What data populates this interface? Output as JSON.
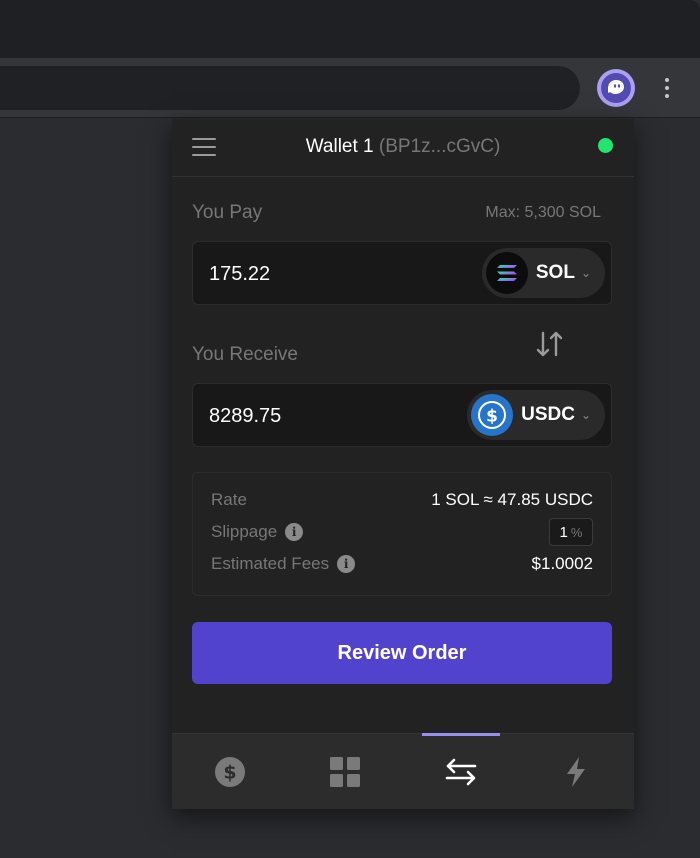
{
  "browser": {
    "extension_icon": "phantom-ghost-icon",
    "menu_icon": "kebab-menu-icon"
  },
  "header": {
    "wallet_name": "Wallet 1",
    "wallet_address": "(BP1z...cGvC)",
    "status_color": "#21e56f"
  },
  "pay": {
    "label": "You Pay",
    "max_label": "Max: 5,300 SOL",
    "amount": "175.22",
    "token": "SOL",
    "token_icon": "solana-icon"
  },
  "receive": {
    "label": "You Receive",
    "amount": "8289.75",
    "token": "USDC",
    "token_icon": "usdc-icon"
  },
  "details": {
    "rate_label": "Rate",
    "rate_value": "1 SOL ≈ 47.85 USDC",
    "slippage_label": "Slippage",
    "slippage_value": "1",
    "slippage_unit": "%",
    "fees_label": "Estimated Fees",
    "fees_value": "$1.0002"
  },
  "actions": {
    "review_label": "Review Order"
  },
  "nav": {
    "tabs": [
      {
        "icon": "dollar-icon",
        "active": false
      },
      {
        "icon": "grid-icon",
        "active": false
      },
      {
        "icon": "swap-arrows-icon",
        "active": true
      },
      {
        "icon": "lightning-icon",
        "active": false
      }
    ]
  },
  "colors": {
    "accent": "#5243cf",
    "active_tab": "#9a8df0",
    "background": "#222222"
  }
}
